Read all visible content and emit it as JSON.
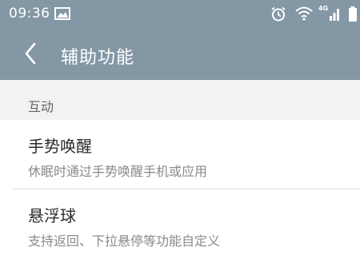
{
  "status_bar": {
    "time": "09:36",
    "network_type": "4G",
    "icons": [
      "image-icon",
      "alarm-icon",
      "wifi-icon",
      "signal-icon",
      "battery-icon"
    ]
  },
  "header": {
    "back_icon": "chevron-left-icon",
    "title": "辅助功能",
    "background_color": "#8497a5"
  },
  "sections": [
    {
      "header": "互动",
      "items": [
        {
          "title": "手势唤醒",
          "subtitle": "休眠时通过手势唤醒手机或应用"
        },
        {
          "title": "悬浮球",
          "subtitle": "支持返回、下拉悬停等功能自定义"
        }
      ]
    }
  ]
}
